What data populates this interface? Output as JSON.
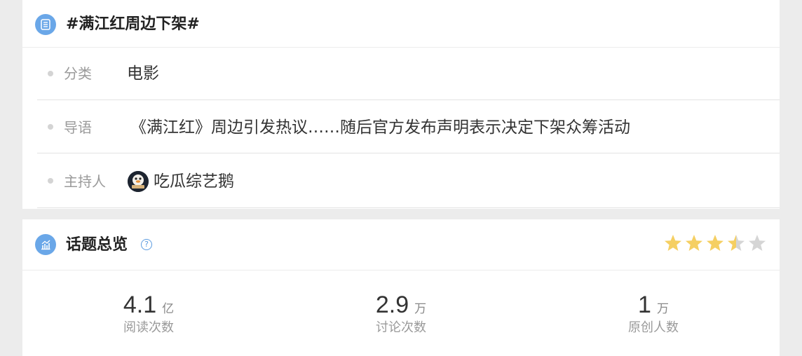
{
  "topic_card": {
    "title": "#满江红周边下架#",
    "icon": "document-list-icon",
    "rows": {
      "category": {
        "label": "分类",
        "value": "电影"
      },
      "intro": {
        "label": "导语",
        "value": "《满江红》周边引发热议……随后官方发布声明表示决定下架众筹活动"
      },
      "host": {
        "label": "主持人",
        "value": "吃瓜综艺鹅",
        "avatar": "host-avatar"
      }
    }
  },
  "overview_card": {
    "title": "话题总览",
    "icon": "trend-chart-icon",
    "help_icon": "question-mark-icon",
    "help_glyph": "?",
    "rating": {
      "value": 3.5,
      "max": 5
    },
    "colors": {
      "star_on": "#f5cf62",
      "star_off": "#d5d5d5",
      "accent": "#6aa7e8"
    },
    "stats": [
      {
        "num": "4.1",
        "unit": "亿",
        "caption": "阅读次数"
      },
      {
        "num": "2.9",
        "unit": "万",
        "caption": "讨论次数"
      },
      {
        "num": "1",
        "unit": "万",
        "caption": "原创人数"
      }
    ]
  }
}
